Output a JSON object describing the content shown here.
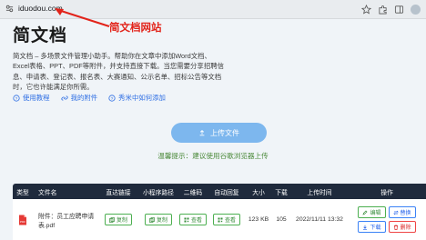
{
  "browser": {
    "url": "iduodou.com"
  },
  "annotation": {
    "text": "简文档网站",
    "color": "#e2231a"
  },
  "page": {
    "title": "简文档",
    "description": "简文档 – 多场景文件管理小助手。帮助你在文章中添加Word文档、Excel表格、PPT、PDF等附件，并支持直接下载。当您需要分享招聘信息、申请表、登记表、报名表、大赛通知、公示名单、招标公告等文档时，它也许能满足你所需。",
    "help_links": [
      {
        "label": "使用教程",
        "icon": "help-circle-icon"
      },
      {
        "label": "我的附件",
        "icon": "link-icon"
      },
      {
        "label": "秀米中如何添加",
        "icon": "help-circle-icon"
      }
    ],
    "upload_label": "上传文件",
    "hint": "温馨提示：建议使用谷歌浏览器上传"
  },
  "table": {
    "headers": [
      "类型",
      "文件名",
      "直达链接",
      "小程序路径",
      "二维码",
      "自动回复",
      "大小",
      "下载",
      "上传时间",
      "操作"
    ],
    "row": {
      "file_name": "附件：员工应聘申请表.pdf",
      "link_btn": "复制",
      "mini_btn": "复制",
      "qr_btn": "查看",
      "auto_btn": "查看",
      "size": "123 KB",
      "downloads": "105",
      "upload_time": "2022/11/11 13:32",
      "ops": {
        "edit": "编辑",
        "replace": "替换",
        "download": "下载",
        "delete": "删除"
      }
    }
  },
  "colors": {
    "accent": "#7db7ee",
    "header_bg": "#1f2a3c",
    "link": "#2f6fe4",
    "hint": "#4b8a3a"
  }
}
